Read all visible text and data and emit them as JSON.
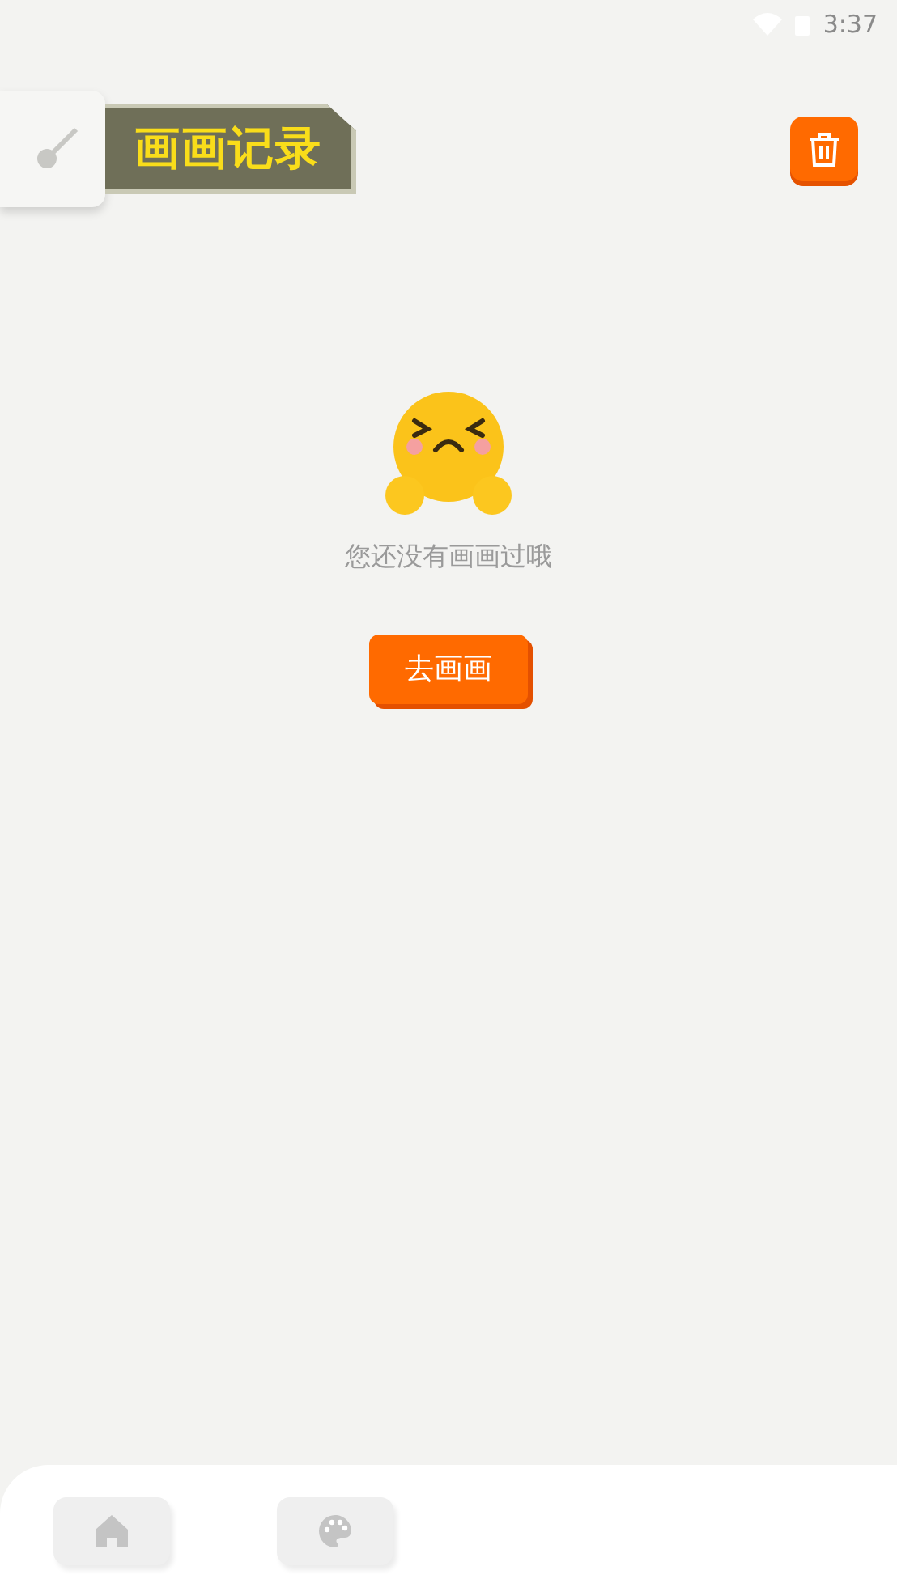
{
  "status_bar": {
    "time": "3:37"
  },
  "header": {
    "title": "画画记录"
  },
  "empty_state": {
    "message": "您还没有画画过哦",
    "action": "去画画"
  },
  "bottom_nav": [
    {
      "kind": "home",
      "selected": false
    },
    {
      "kind": "palette",
      "selected": false
    }
  ]
}
